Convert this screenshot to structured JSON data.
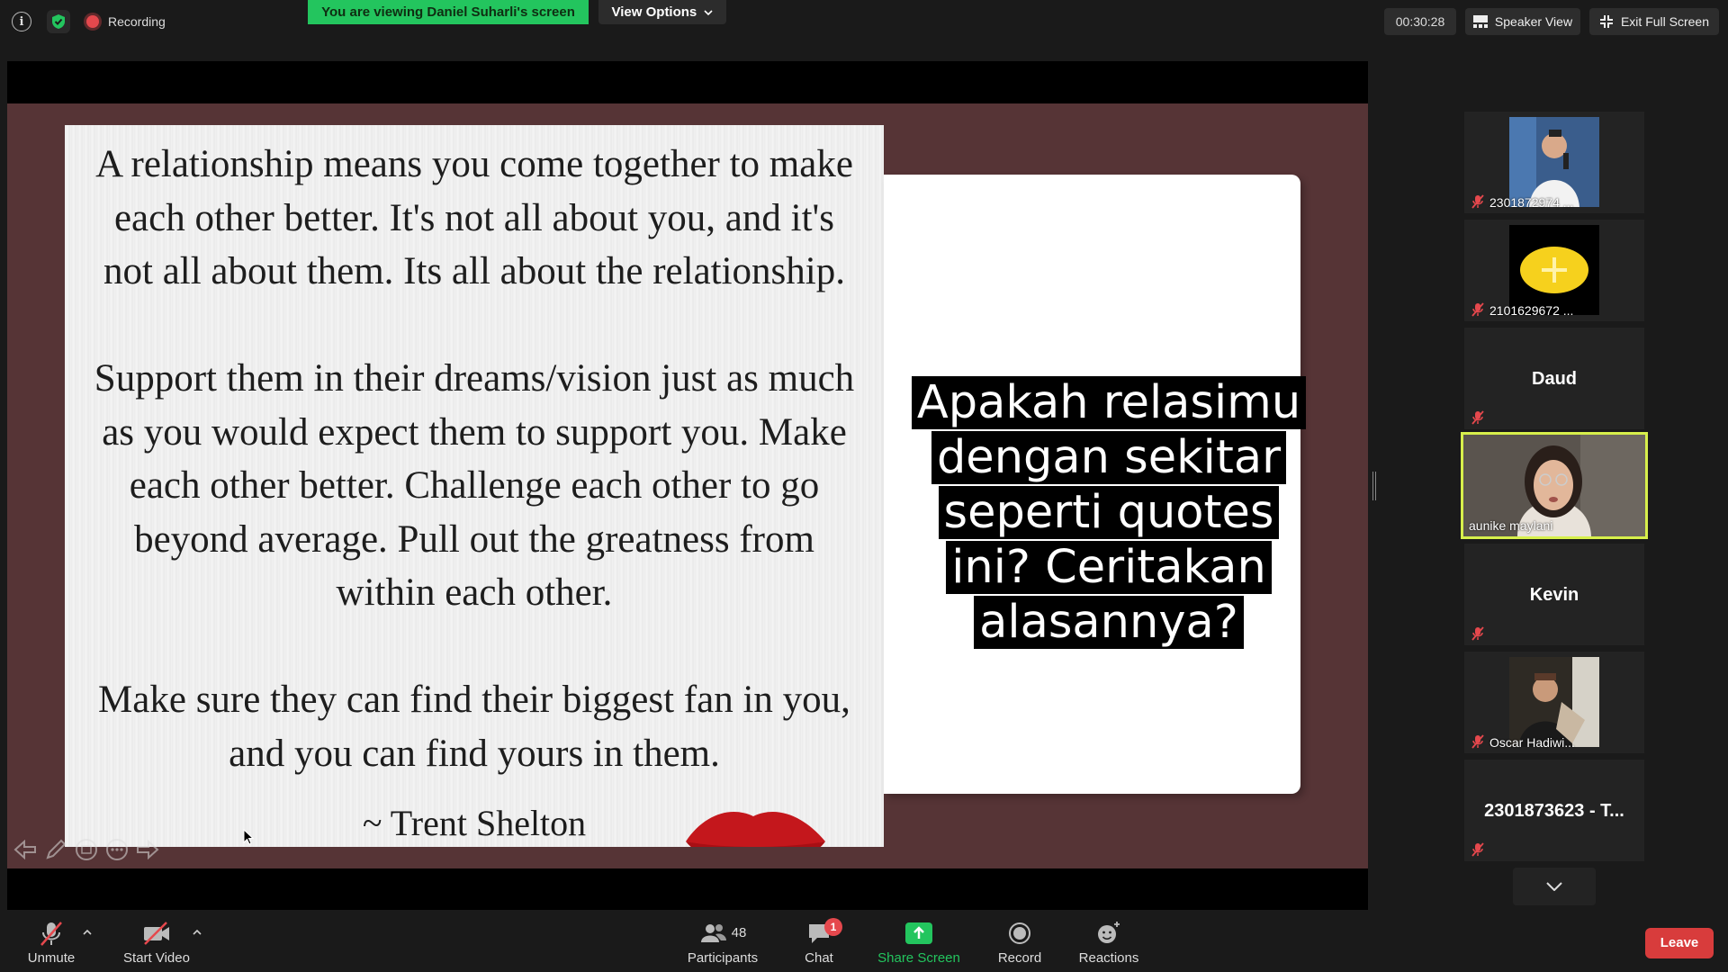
{
  "top_bar": {
    "recording_label": "Recording",
    "viewing_banner": "You are viewing Daniel Suharli's screen",
    "view_options_label": "View Options",
    "timer": "00:30:28",
    "speaker_view_label": "Speaker View",
    "exit_fullscreen_label": "Exit Full Screen"
  },
  "slide": {
    "quote_lines": [
      "A relationship means you come together to make",
      "each other better. It's not all about you, and it's",
      "not all about them. Its all about the relationship.",
      "",
      "Support them in their dreams/vision just as much",
      "as you would expect them to support you. Make",
      "each other better. Challenge each other to go",
      "beyond average. Pull out the greatness from",
      "within each other.",
      "",
      "Make sure they can find their biggest fan in you,",
      "and you can find yours in them."
    ],
    "author": "~ Trent Shelton",
    "question_lines": [
      "Apakah relasimu",
      "dengan sekitar",
      "seperti quotes",
      "ini? Ceritakan",
      "alasannya?"
    ]
  },
  "participants_panel": {
    "tiles": [
      {
        "name": "2301872974 ...",
        "type": "video-photo-1"
      },
      {
        "name": "2101629672 ...",
        "type": "video-photo-2"
      },
      {
        "name": "Daud",
        "type": "name-only"
      },
      {
        "name": "aunike maylani",
        "type": "active-speaker"
      },
      {
        "name": "Kevin",
        "type": "name-only"
      },
      {
        "name": "Oscar Hadiwi...",
        "type": "video-photo-3"
      },
      {
        "name": "2301873623 - T...",
        "type": "name-only"
      }
    ]
  },
  "toolbar": {
    "unmute_label": "Unmute",
    "start_video_label": "Start Video",
    "participants_label": "Participants",
    "participants_count": "48",
    "chat_label": "Chat",
    "chat_badge": "1",
    "share_screen_label": "Share Screen",
    "record_label": "Record",
    "reactions_label": "Reactions",
    "leave_label": "Leave"
  },
  "colors": {
    "viewing_banner": "#23c55e",
    "share_screen_icon": "#23c55e",
    "leave_button": "#d83c3c",
    "active_speaker_border": "#d7ef4b",
    "recording_dot": "#e5484d",
    "slide_background": "#563436"
  }
}
